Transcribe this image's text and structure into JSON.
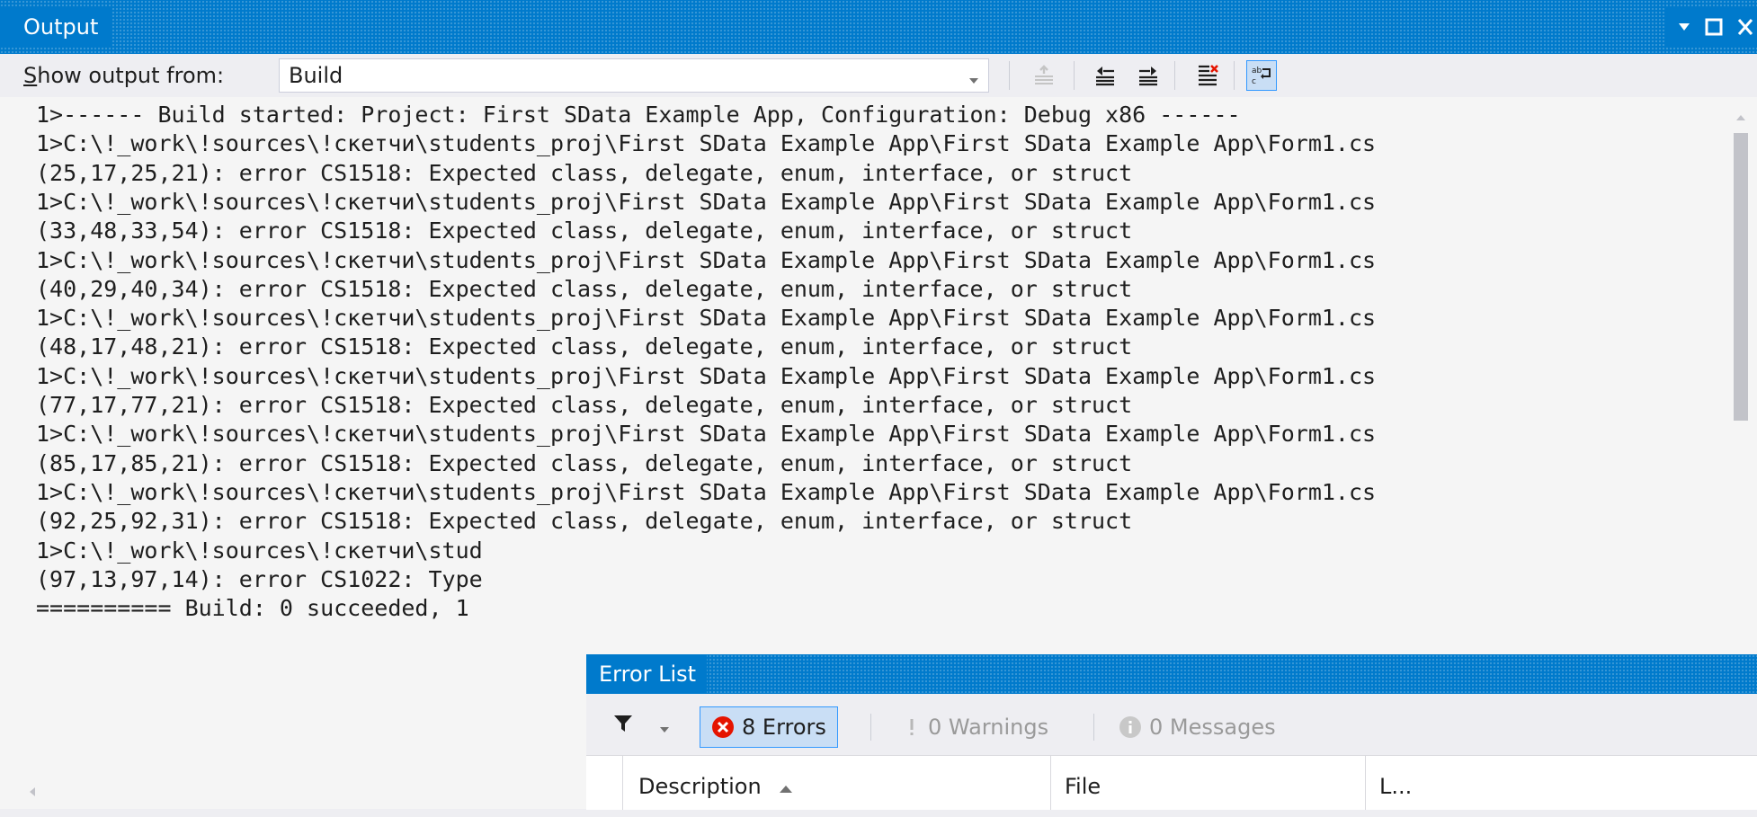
{
  "output_window": {
    "title": "Output",
    "show_output_from_label": "Show output from:",
    "source_selected": "Build",
    "lines": [
      "1>------ Build started: Project: First SData Example App, Configuration: Debug x86 ------",
      "1>C:\\!_work\\!sources\\!скетчи\\students_proj\\First SData Example App\\First SData Example App\\Form1.cs",
      "(25,17,25,21): error CS1518: Expected class, delegate, enum, interface, or struct",
      "1>C:\\!_work\\!sources\\!скетчи\\students_proj\\First SData Example App\\First SData Example App\\Form1.cs",
      "(33,48,33,54): error CS1518: Expected class, delegate, enum, interface, or struct",
      "1>C:\\!_work\\!sources\\!скетчи\\students_proj\\First SData Example App\\First SData Example App\\Form1.cs",
      "(40,29,40,34): error CS1518: Expected class, delegate, enum, interface, or struct",
      "1>C:\\!_work\\!sources\\!скетчи\\students_proj\\First SData Example App\\First SData Example App\\Form1.cs",
      "(48,17,48,21): error CS1518: Expected class, delegate, enum, interface, or struct",
      "1>C:\\!_work\\!sources\\!скетчи\\students_proj\\First SData Example App\\First SData Example App\\Form1.cs",
      "(77,17,77,21): error CS1518: Expected class, delegate, enum, interface, or struct",
      "1>C:\\!_work\\!sources\\!скетчи\\students_proj\\First SData Example App\\First SData Example App\\Form1.cs",
      "(85,17,85,21): error CS1518: Expected class, delegate, enum, interface, or struct",
      "1>C:\\!_work\\!sources\\!скетчи\\students_proj\\First SData Example App\\First SData Example App\\Form1.cs",
      "(92,25,92,31): error CS1518: Expected class, delegate, enum, interface, or struct",
      "1>C:\\!_work\\!sources\\!скетчи\\stud",
      "(97,13,97,14): error CS1022: Type",
      "========== Build: 0 succeeded, 1"
    ],
    "toolbar_icons": [
      "go-to-location-icon",
      "previous-message-icon",
      "next-message-icon",
      "clear-all-icon",
      "word-wrap-icon"
    ]
  },
  "error_list": {
    "title": "Error List",
    "errors_label": "8 Errors",
    "warnings_label": "0 Warnings",
    "messages_label": "0 Messages",
    "columns": {
      "description": "Description",
      "file": "File",
      "line": "L..."
    }
  },
  "colors": {
    "titlebar": "#007acc",
    "background": "#eeeef2",
    "error_red": "#e51400",
    "selected_highlight": "#c9def5"
  }
}
